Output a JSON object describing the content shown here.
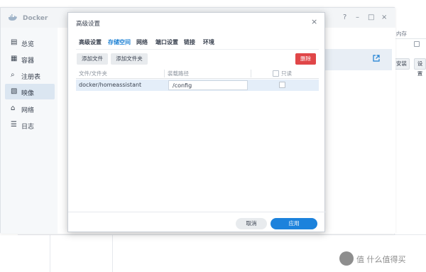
{
  "app": {
    "title": "Docker",
    "window_controls": [
      "?",
      "–",
      "□",
      "×"
    ]
  },
  "sidebar": {
    "items": [
      {
        "label": "总览",
        "icon": "overview-icon",
        "glyph": "▤"
      },
      {
        "label": "容器",
        "icon": "container-icon",
        "glyph": "▦"
      },
      {
        "label": "注册表",
        "icon": "registry-icon",
        "glyph": "⌕"
      },
      {
        "label": "映像",
        "icon": "image-icon",
        "glyph": "▧",
        "active": true
      },
      {
        "label": "网络",
        "icon": "network-icon",
        "glyph": "⌂"
      },
      {
        "label": "日志",
        "icon": "log-icon",
        "glyph": "☰"
      }
    ]
  },
  "background_window": {
    "memory_header": "内存",
    "install_button": "安装",
    "settings_button": "设置"
  },
  "dialog": {
    "title": "高级设置",
    "close_glyph": "×",
    "tabs": [
      {
        "label": "高级设置",
        "active": false
      },
      {
        "label": "存储空间",
        "active": true
      },
      {
        "label": "网络",
        "active": false
      },
      {
        "label": "端口设置",
        "active": false
      },
      {
        "label": "链接",
        "active": false
      },
      {
        "label": "环境",
        "active": false
      }
    ],
    "toolbar": {
      "add_file": "添加文件",
      "add_folder": "添加文件夹",
      "delete": "删除"
    },
    "table": {
      "columns": [
        "文件/文件夹",
        "装载路径",
        "只读"
      ],
      "rows": [
        {
          "folder": "docker/homeassistant",
          "mount_path": "/config",
          "readonly": false
        }
      ]
    },
    "footer": {
      "cancel": "取消",
      "apply": "应用"
    }
  },
  "watermark": {
    "text": "值 什么值得买"
  },
  "colors": {
    "accent": "#1c82dc",
    "danger": "#e04648",
    "active_tab": "#1a7fd3",
    "selected_row": "#e4eef9"
  }
}
